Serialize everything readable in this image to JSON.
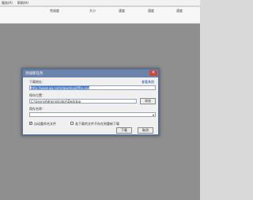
{
  "menubar": {
    "items": [
      "服务(A)",
      "帮助(H)"
    ]
  },
  "columns": [
    "完成度",
    "大小",
    "速度",
    "速度",
    "速度"
  ],
  "dialog": {
    "title": "添加新任务",
    "close_glyph": "✕",
    "url_label": "下载地址：",
    "url_link": "查看其他",
    "url_value": "http://www.qq.com/download/file.exe",
    "save_path_label": "保存位置：",
    "save_path_value": "C:\\Users\\Administrator\\Desktop",
    "browse_label": "浏览",
    "save_name_label": "保存名称：",
    "save_name_value": "",
    "checkbox1_label": "自动重命名文件",
    "checkbox1_checked": true,
    "checkbox2_label": "若下载的文件不存在则重新下载",
    "checkbox2_checked": false,
    "download_button": "下载",
    "cancel_button": "取消"
  }
}
